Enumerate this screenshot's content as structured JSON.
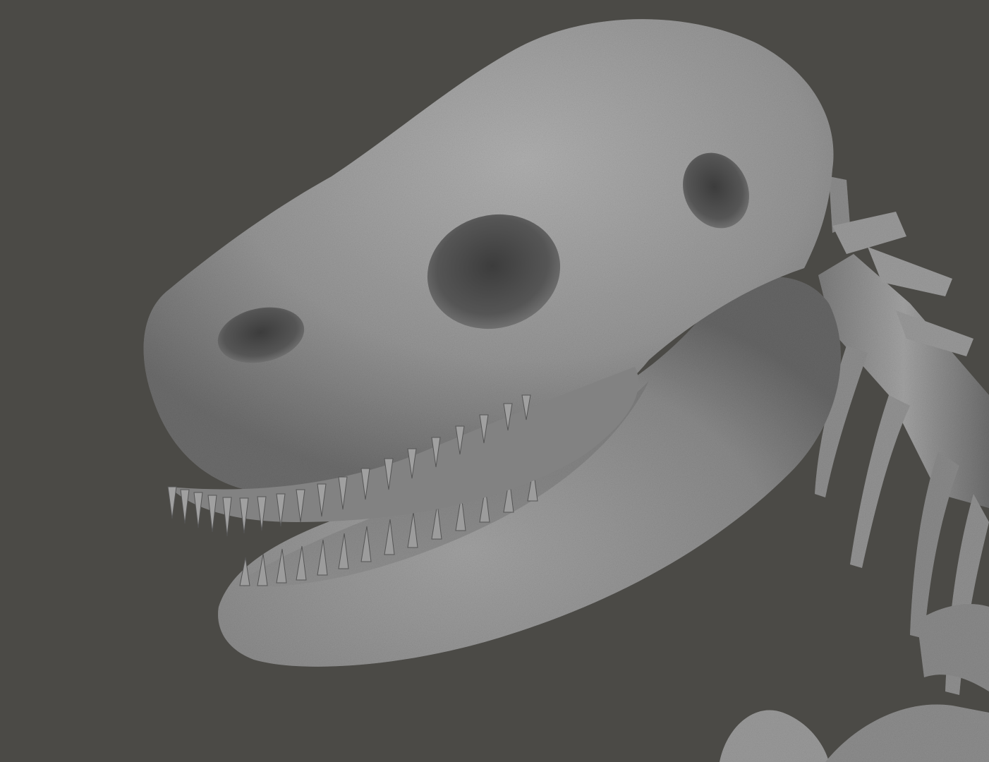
{
  "scene": {
    "subject": "dinosaur-skeleton-skull-render",
    "colors": {
      "background": "#4b4a46",
      "bone_light": "#a6a6a6",
      "bone_mid": "#8a8a8a",
      "bone_dark": "#5e5e5e",
      "cavity": "#3a3a3a"
    }
  }
}
